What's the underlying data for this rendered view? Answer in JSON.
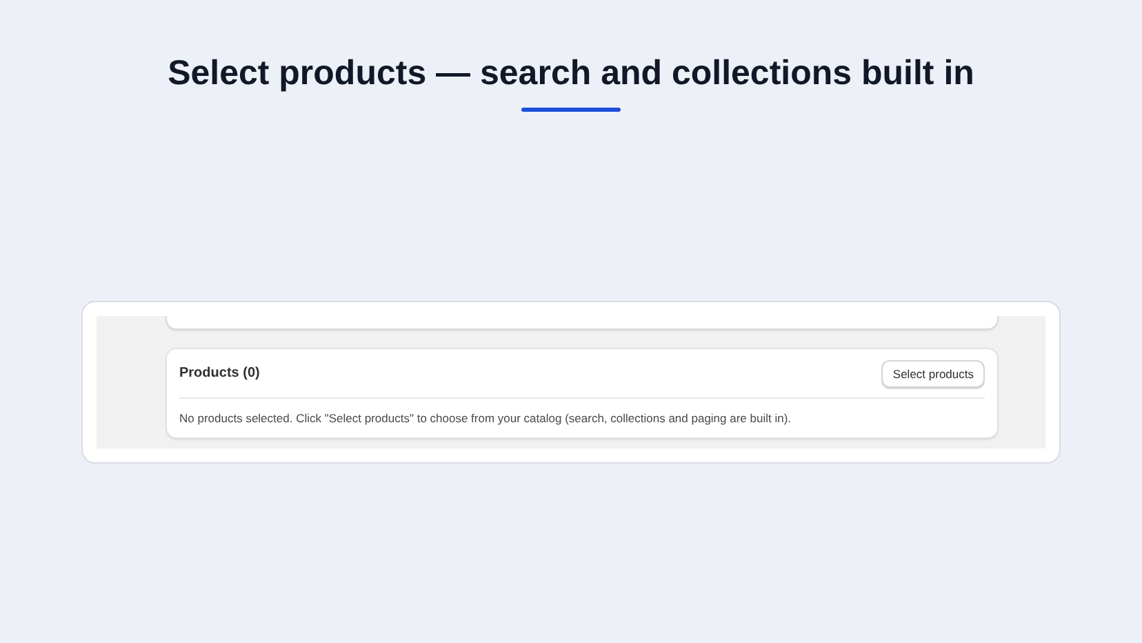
{
  "heading": "Select products — search and collections built in",
  "products_card": {
    "title": "Products (0)",
    "button": "Select products",
    "empty_message": "No products selected. Click \"Select products\" to choose from your catalog (search, collections and paging are built in)."
  }
}
